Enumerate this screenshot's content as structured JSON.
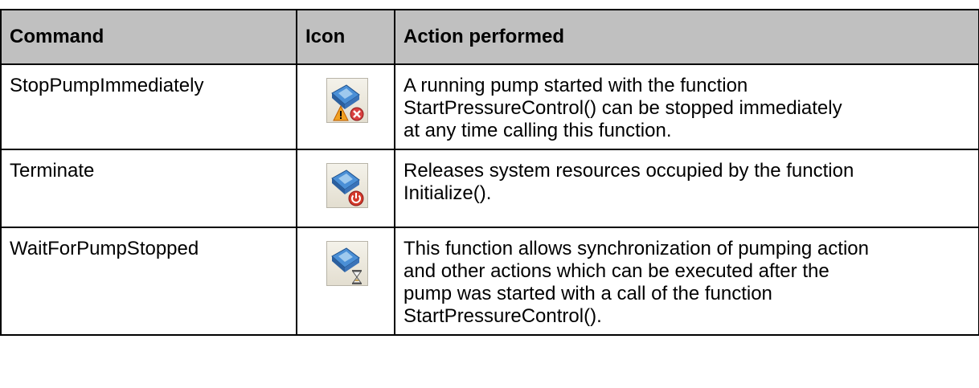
{
  "headers": {
    "command": "Command",
    "icon": "Icon",
    "action": "Action performed"
  },
  "rows": [
    {
      "command": "StopPumpImmediately",
      "icon": "pump-stop-warning-icon",
      "action": [
        "A running pump started with the function",
        "StartPressureControl() can be stopped immediately",
        "at any time calling this function."
      ]
    },
    {
      "command": "Terminate",
      "icon": "pump-power-off-icon",
      "action": [
        "Releases system resources occupied by the function",
        "Initialize()."
      ]
    },
    {
      "command": "WaitForPumpStopped",
      "icon": "pump-hourglass-icon",
      "action": [
        "This function allows synchronization of pumping action",
        "and other actions which can be executed after the",
        "pump was started with a call of the function",
        "StartPressureControl()."
      ]
    }
  ],
  "colors": {
    "header_bg": "#c0c0c0",
    "border": "#000000",
    "icon_bg": "#ece9d8"
  }
}
